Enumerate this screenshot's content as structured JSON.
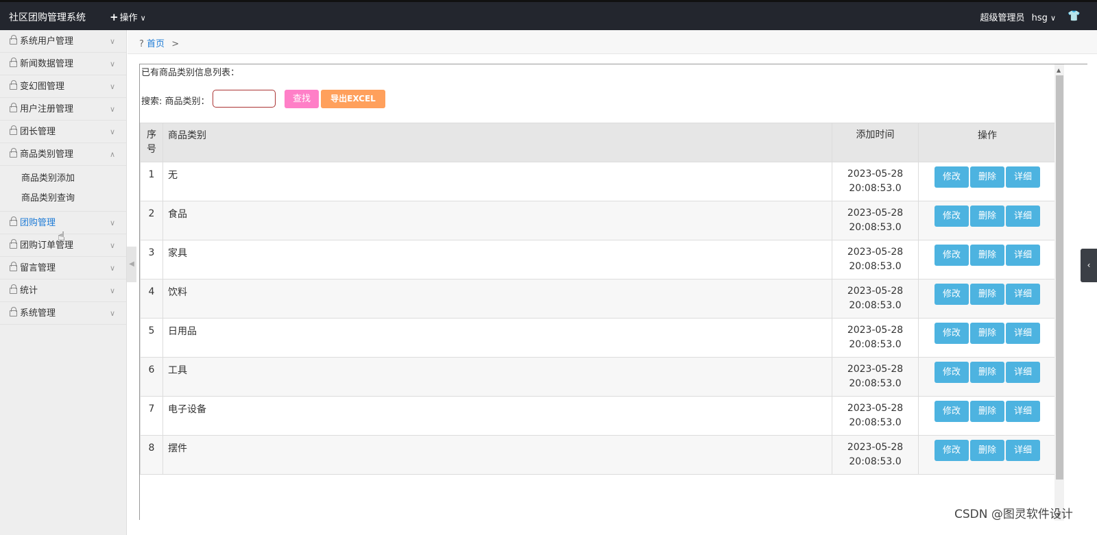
{
  "topbar": {
    "brand": "社区团购管理系统",
    "ops_label": "操作",
    "user_label": "超级管理员",
    "username": "hsg"
  },
  "sidebar": {
    "items": [
      {
        "label": "系统用户管理"
      },
      {
        "label": "新闻数据管理"
      },
      {
        "label": "变幻图管理"
      },
      {
        "label": "用户注册管理"
      },
      {
        "label": "团长管理"
      },
      {
        "label": "商品类别管理",
        "expanded": true,
        "children": [
          "商品类别添加",
          "商品类别查询"
        ]
      },
      {
        "label": "团购管理",
        "active": true
      },
      {
        "label": "团购订单管理"
      },
      {
        "label": "留言管理"
      },
      {
        "label": "统计"
      },
      {
        "label": "系统管理"
      }
    ]
  },
  "breadcrumb": {
    "prefix": "?",
    "home": "首页",
    "sep": ">"
  },
  "main": {
    "list_title": "已有商品类别信息列表：",
    "search_label": "搜索: 商品类别：",
    "search_value": "",
    "search_button": "查找",
    "export_button": "导出EXCEL",
    "table": {
      "headers": {
        "idx": "序号",
        "category": "商品类别",
        "time": "添加时间",
        "ops": "操作"
      },
      "rows": [
        {
          "idx": "1",
          "category": "无",
          "date": "2023-05-28",
          "time": "20:08:53.0"
        },
        {
          "idx": "2",
          "category": "食品",
          "date": "2023-05-28",
          "time": "20:08:53.0"
        },
        {
          "idx": "3",
          "category": "家具",
          "date": "2023-05-28",
          "time": "20:08:53.0"
        },
        {
          "idx": "4",
          "category": "饮料",
          "date": "2023-05-28",
          "time": "20:08:53.0"
        },
        {
          "idx": "5",
          "category": "日用品",
          "date": "2023-05-28",
          "time": "20:08:53.0"
        },
        {
          "idx": "6",
          "category": "工具",
          "date": "2023-05-28",
          "time": "20:08:53.0"
        },
        {
          "idx": "7",
          "category": "电子设备",
          "date": "2023-05-28",
          "time": "20:08:53.0"
        },
        {
          "idx": "8",
          "category": "摆件",
          "date": "2023-05-28",
          "time": "20:08:53.0"
        }
      ],
      "op_labels": {
        "edit": "修改",
        "delete": "删除",
        "detail": "详细"
      }
    }
  },
  "watermark": "CSDN @图灵软件设计",
  "colors": {
    "topbar": "#23262e",
    "search_button": "#ff7fc7",
    "export_button": "#ffa05c",
    "op_button": "#4db3e0",
    "active_nav": "#1e7bd6"
  }
}
